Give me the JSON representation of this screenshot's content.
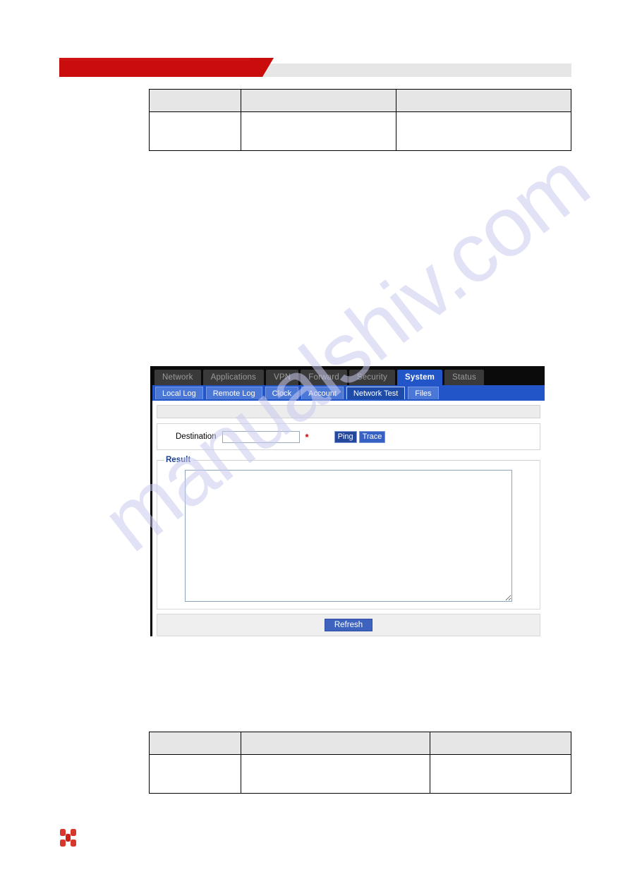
{
  "document": {
    "watermark": "manualshiv.com",
    "brand_color": "#c90c0c",
    "accent_color": "#2255c8",
    "header_banner_label": "",
    "logo_name": "hongdian-logo"
  },
  "tables": {
    "top": {
      "header_cells": [
        "",
        "",
        ""
      ],
      "body_cells": [
        "",
        "",
        ""
      ]
    },
    "bottom": {
      "header_cells": [
        "",
        "",
        ""
      ],
      "body_cells": [
        "",
        "",
        ""
      ]
    }
  },
  "router_ui": {
    "main_tabs": [
      {
        "label": "Network",
        "active": false
      },
      {
        "label": "Applications",
        "active": false
      },
      {
        "label": "VPN",
        "active": false
      },
      {
        "label": "Forward",
        "active": false
      },
      {
        "label": "Security",
        "active": false
      },
      {
        "label": "System",
        "active": true
      },
      {
        "label": "Status",
        "active": false
      }
    ],
    "sub_tabs": [
      {
        "label": "Local Log",
        "active": false
      },
      {
        "label": "Remote Log",
        "active": false
      },
      {
        "label": "Clock",
        "active": false
      },
      {
        "label": "Account",
        "active": false
      },
      {
        "label": "Network Test",
        "active": true
      },
      {
        "label": "Files",
        "active": false
      }
    ],
    "title_strip": "",
    "form": {
      "destination_label": "Destination",
      "destination_value": "",
      "destination_placeholder": "",
      "required_marker": "*",
      "ping_button": "Ping",
      "trace_button": "Trace"
    },
    "result": {
      "legend": "Result",
      "text": "",
      "placeholder": ""
    },
    "footer": {
      "refresh_button": "Refresh"
    }
  }
}
